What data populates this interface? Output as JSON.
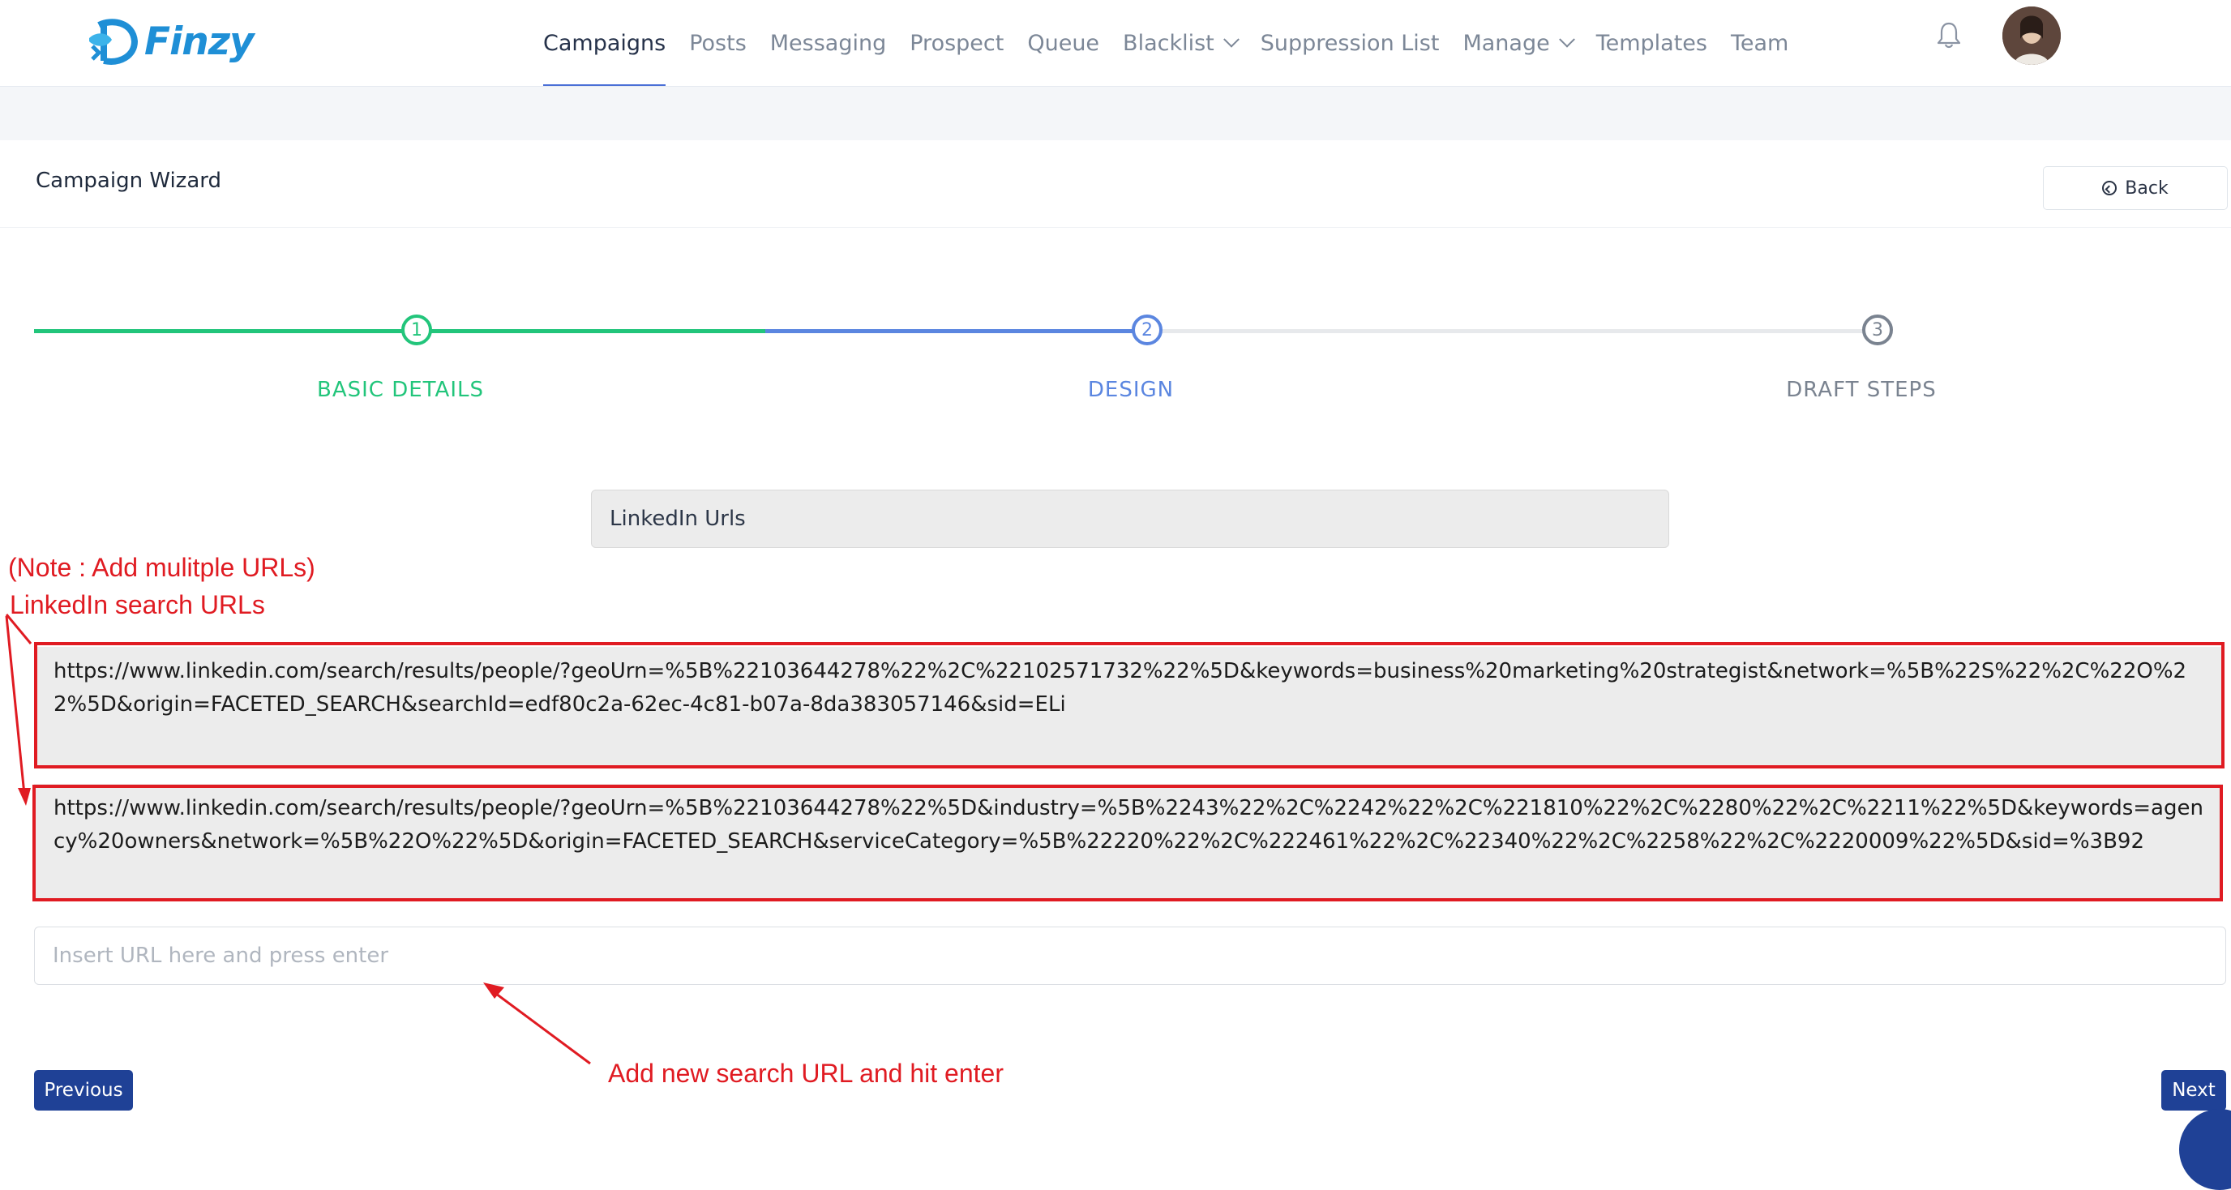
{
  "brand": {
    "name": "Finzy"
  },
  "nav": {
    "items": [
      {
        "label": "Campaigns",
        "active": true,
        "dropdown": false
      },
      {
        "label": "Posts",
        "active": false,
        "dropdown": false
      },
      {
        "label": "Messaging",
        "active": false,
        "dropdown": false
      },
      {
        "label": "Prospect",
        "active": false,
        "dropdown": false
      },
      {
        "label": "Queue",
        "active": false,
        "dropdown": false
      },
      {
        "label": "Blacklist",
        "active": false,
        "dropdown": true
      },
      {
        "label": "Suppression List",
        "active": false,
        "dropdown": false
      },
      {
        "label": "Manage",
        "active": false,
        "dropdown": true
      },
      {
        "label": "Templates",
        "active": false,
        "dropdown": false
      },
      {
        "label": "Team",
        "active": false,
        "dropdown": false
      }
    ],
    "icons": {
      "notifications": "bell-icon",
      "profile": "avatar"
    }
  },
  "header": {
    "title": "Campaign Wizard",
    "back_label": "Back",
    "back_icon": "circle-arrow-left-icon"
  },
  "stepper": {
    "steps": [
      {
        "number": "1",
        "label": "BASIC DETAILS",
        "state": "complete"
      },
      {
        "number": "2",
        "label": "DESIGN",
        "state": "current"
      },
      {
        "number": "3",
        "label": "DRAFT STEPS",
        "state": "pending"
      }
    ],
    "colors": {
      "complete": "#22c57b",
      "current": "#5b86e0",
      "pending": "#7a8390"
    }
  },
  "form": {
    "section_label": "LinkedIn Urls",
    "urls": [
      "https://www.linkedin.com/search/results/people/?geoUrn=%5B%22103644278%22%2C%22102571732%22%5D&keywords=business%20marketing%20strategist&network=%5B%22S%22%2C%22O%22%5D&origin=FACETED_SEARCH&searchId=edf80c2a-62ec-4c81-b07a-8da383057146&sid=ELi",
      "https://www.linkedin.com/search/results/people/?geoUrn=%5B%22103644278%22%5D&industry=%5B%2243%22%2C%2242%22%2C%221810%22%2C%2280%22%2C%2211%22%5D&keywords=agency%20owners&network=%5B%22O%22%5D&origin=FACETED_SEARCH&serviceCategory=%5B%22220%22%2C%222461%22%2C%22340%22%2C%2258%22%2C%2220009%22%5D&sid=%3B92"
    ],
    "url_input": {
      "value": "",
      "placeholder": "Insert URL here and press enter"
    }
  },
  "annotations": {
    "note": "(Note : Add mulitple URLs)",
    "linkedin_search_urls": "LinkedIn search URLs",
    "add_new_hint": "Add new search URL and hit enter",
    "color": "#e01b22"
  },
  "footer": {
    "previous_label": "Previous",
    "next_label": "Next",
    "button_color": "#1f4196"
  }
}
